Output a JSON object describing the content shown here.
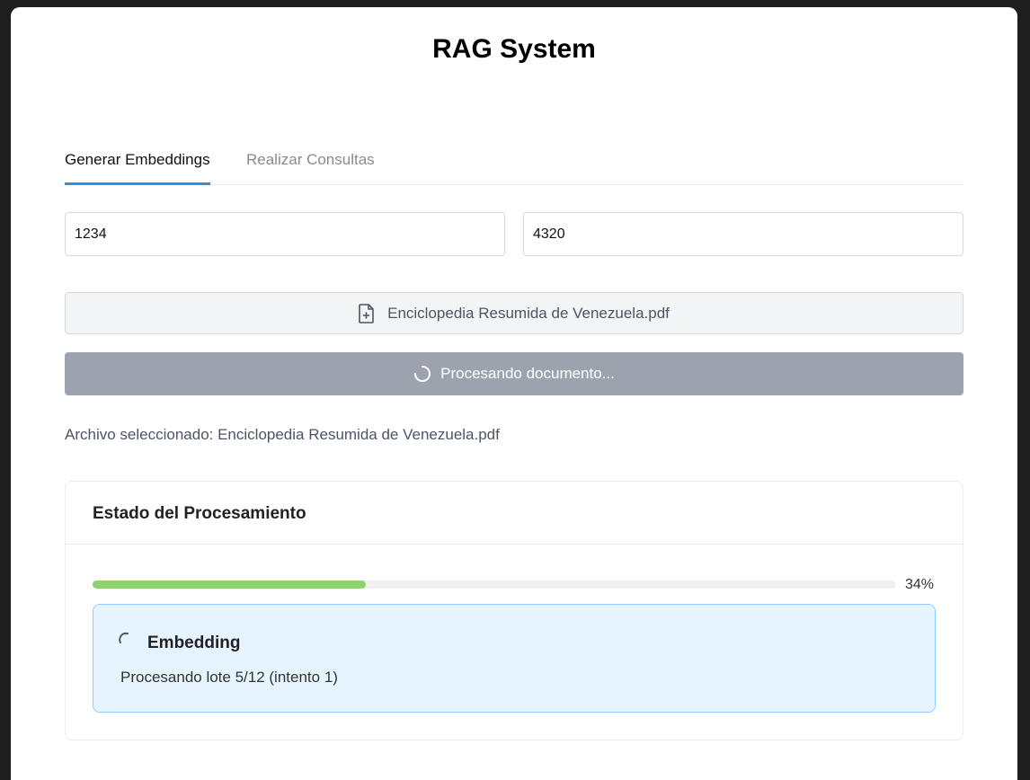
{
  "header": {
    "title": "RAG System"
  },
  "tabs": [
    {
      "label": "Generar Embeddings",
      "active": true
    },
    {
      "label": "Realizar Consultas",
      "active": false
    }
  ],
  "form": {
    "field_left_value": "1234",
    "field_right_value": "4320",
    "file_button_label": "Enciclopedia Resumida de Venezuela.pdf",
    "file_icon": "file-plus-icon",
    "process_button_label": "Procesando documento...",
    "process_icon": "spinner-icon",
    "selected_file_text": "Archivo seleccionado: Enciclopedia Resumida de Venezuela.pdf"
  },
  "status": {
    "title": "Estado del Procesamiento",
    "progress_percent": 34,
    "progress_label": "34%",
    "step": {
      "icon": "loading-spinner-icon",
      "title": "Embedding",
      "description": "Procesando lote 5/12 (intento 1)"
    }
  },
  "colors": {
    "accent": "#2e8fe0",
    "progress": "#8cd26d",
    "disabled_button": "#9ca3af",
    "info_bg": "#e6f4ff",
    "info_border": "#91caff"
  }
}
